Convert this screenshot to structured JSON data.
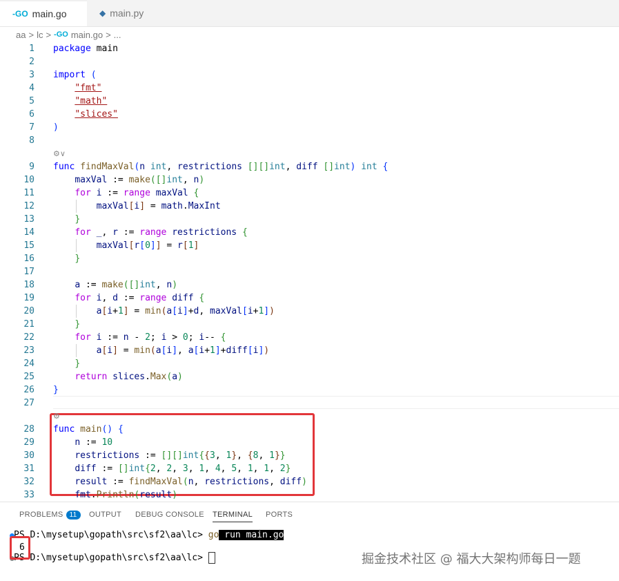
{
  "tabs": [
    {
      "label": "main.go",
      "icon": "go-file-icon",
      "active": true
    },
    {
      "label": "main.py",
      "icon": "python-file-icon",
      "active": false
    }
  ],
  "breadcrumb": {
    "items": [
      "aa",
      ">",
      "lc",
      ">",
      "main.go",
      ">",
      "..."
    ]
  },
  "editor": {
    "code_lines": [
      {
        "n": "1",
        "tokens": [
          [
            "kw",
            "package"
          ],
          [
            "pl",
            " main"
          ]
        ]
      },
      {
        "n": "2",
        "tokens": []
      },
      {
        "n": "3",
        "tokens": [
          [
            "kw",
            "import"
          ],
          [
            "pl",
            " "
          ],
          [
            "p1",
            "("
          ]
        ]
      },
      {
        "n": "4",
        "tokens": [
          [
            "pl",
            "    "
          ],
          [
            "str",
            "\"fmt\""
          ]
        ]
      },
      {
        "n": "5",
        "tokens": [
          [
            "pl",
            "    "
          ],
          [
            "str",
            "\"math\""
          ]
        ]
      },
      {
        "n": "6",
        "tokens": [
          [
            "pl",
            "    "
          ],
          [
            "str",
            "\"slices\""
          ]
        ]
      },
      {
        "n": "7",
        "tokens": [
          [
            "p1",
            ")"
          ]
        ]
      },
      {
        "n": "8",
        "tokens": []
      },
      {
        "lens": "⚙∨"
      },
      {
        "n": "9",
        "tokens": [
          [
            "kw",
            "func"
          ],
          [
            "pl",
            " "
          ],
          [
            "fn",
            "findMaxVal"
          ],
          [
            "p1",
            "("
          ],
          [
            "var",
            "n"
          ],
          [
            "pl",
            " "
          ],
          [
            "ty",
            "int"
          ],
          [
            "pl",
            ", "
          ],
          [
            "var",
            "restrictions"
          ],
          [
            "pl",
            " "
          ],
          [
            "p2",
            "[][]"
          ],
          [
            "ty",
            "int"
          ],
          [
            "pl",
            ", "
          ],
          [
            "var",
            "diff"
          ],
          [
            "pl",
            " "
          ],
          [
            "p2",
            "[]"
          ],
          [
            "ty",
            "int"
          ],
          [
            "p1",
            ")"
          ],
          [
            "pl",
            " "
          ],
          [
            "ty",
            "int"
          ],
          [
            "pl",
            " "
          ],
          [
            "p1",
            "{"
          ]
        ]
      },
      {
        "n": "10",
        "tokens": [
          [
            "pl",
            "    "
          ],
          [
            "var",
            "maxVal"
          ],
          [
            "pl",
            " := "
          ],
          [
            "fn",
            "make"
          ],
          [
            "p2",
            "([]"
          ],
          [
            "ty",
            "int"
          ],
          [
            "pl",
            ", "
          ],
          [
            "var",
            "n"
          ],
          [
            "p2",
            ")"
          ]
        ]
      },
      {
        "n": "11",
        "tokens": [
          [
            "pl",
            "    "
          ],
          [
            "kw2",
            "for"
          ],
          [
            "pl",
            " "
          ],
          [
            "var",
            "i"
          ],
          [
            "pl",
            " := "
          ],
          [
            "kw2",
            "range"
          ],
          [
            "pl",
            " "
          ],
          [
            "var",
            "maxVal"
          ],
          [
            "pl",
            " "
          ],
          [
            "p2",
            "{"
          ]
        ]
      },
      {
        "n": "12",
        "tokens": [
          [
            "pl",
            "        "
          ],
          [
            "var",
            "maxVal"
          ],
          [
            "p3",
            "["
          ],
          [
            "var",
            "i"
          ],
          [
            "p3",
            "]"
          ],
          [
            "pl",
            " = "
          ],
          [
            "var",
            "math"
          ],
          [
            "pl",
            "."
          ],
          [
            "var",
            "MaxInt"
          ]
        ]
      },
      {
        "n": "13",
        "tokens": [
          [
            "pl",
            "    "
          ],
          [
            "p2",
            "}"
          ]
        ]
      },
      {
        "n": "14",
        "tokens": [
          [
            "pl",
            "    "
          ],
          [
            "kw2",
            "for"
          ],
          [
            "pl",
            " "
          ],
          [
            "var",
            "_"
          ],
          [
            "pl",
            ", "
          ],
          [
            "var",
            "r"
          ],
          [
            "pl",
            " := "
          ],
          [
            "kw2",
            "range"
          ],
          [
            "pl",
            " "
          ],
          [
            "var",
            "restrictions"
          ],
          [
            "pl",
            " "
          ],
          [
            "p2",
            "{"
          ]
        ]
      },
      {
        "n": "15",
        "tokens": [
          [
            "pl",
            "        "
          ],
          [
            "var",
            "maxVal"
          ],
          [
            "p3",
            "["
          ],
          [
            "var",
            "r"
          ],
          [
            "p1",
            "["
          ],
          [
            "num",
            "0"
          ],
          [
            "p1",
            "]"
          ],
          [
            "p3",
            "]"
          ],
          [
            "pl",
            " = "
          ],
          [
            "var",
            "r"
          ],
          [
            "p3",
            "["
          ],
          [
            "num",
            "1"
          ],
          [
            "p3",
            "]"
          ]
        ]
      },
      {
        "n": "16",
        "tokens": [
          [
            "pl",
            "    "
          ],
          [
            "p2",
            "}"
          ]
        ]
      },
      {
        "n": "17",
        "tokens": []
      },
      {
        "n": "18",
        "tokens": [
          [
            "pl",
            "    "
          ],
          [
            "var",
            "a"
          ],
          [
            "pl",
            " := "
          ],
          [
            "fn",
            "make"
          ],
          [
            "p2",
            "([]"
          ],
          [
            "ty",
            "int"
          ],
          [
            "pl",
            ", "
          ],
          [
            "var",
            "n"
          ],
          [
            "p2",
            ")"
          ]
        ]
      },
      {
        "n": "19",
        "tokens": [
          [
            "pl",
            "    "
          ],
          [
            "kw2",
            "for"
          ],
          [
            "pl",
            " "
          ],
          [
            "var",
            "i"
          ],
          [
            "pl",
            ", "
          ],
          [
            "var",
            "d"
          ],
          [
            "pl",
            " := "
          ],
          [
            "kw2",
            "range"
          ],
          [
            "pl",
            " "
          ],
          [
            "var",
            "diff"
          ],
          [
            "pl",
            " "
          ],
          [
            "p2",
            "{"
          ]
        ]
      },
      {
        "n": "20",
        "tokens": [
          [
            "pl",
            "        "
          ],
          [
            "var",
            "a"
          ],
          [
            "p3",
            "["
          ],
          [
            "var",
            "i"
          ],
          [
            "pl",
            "+"
          ],
          [
            "num",
            "1"
          ],
          [
            "p3",
            "]"
          ],
          [
            "pl",
            " = "
          ],
          [
            "fn",
            "min"
          ],
          [
            "p3",
            "("
          ],
          [
            "var",
            "a"
          ],
          [
            "p1",
            "["
          ],
          [
            "var",
            "i"
          ],
          [
            "p1",
            "]"
          ],
          [
            "pl",
            "+"
          ],
          [
            "var",
            "d"
          ],
          [
            "pl",
            ", "
          ],
          [
            "var",
            "maxVal"
          ],
          [
            "p1",
            "["
          ],
          [
            "var",
            "i"
          ],
          [
            "pl",
            "+"
          ],
          [
            "num",
            "1"
          ],
          [
            "p1",
            "]"
          ],
          [
            "p3",
            ")"
          ]
        ]
      },
      {
        "n": "21",
        "tokens": [
          [
            "pl",
            "    "
          ],
          [
            "p2",
            "}"
          ]
        ]
      },
      {
        "n": "22",
        "tokens": [
          [
            "pl",
            "    "
          ],
          [
            "kw2",
            "for"
          ],
          [
            "pl",
            " "
          ],
          [
            "var",
            "i"
          ],
          [
            "pl",
            " := "
          ],
          [
            "var",
            "n"
          ],
          [
            "pl",
            " - "
          ],
          [
            "num",
            "2"
          ],
          [
            "pl",
            "; "
          ],
          [
            "var",
            "i"
          ],
          [
            "pl",
            " > "
          ],
          [
            "num",
            "0"
          ],
          [
            "pl",
            "; "
          ],
          [
            "var",
            "i"
          ],
          [
            "pl",
            "-- "
          ],
          [
            "p2",
            "{"
          ]
        ]
      },
      {
        "n": "23",
        "tokens": [
          [
            "pl",
            "        "
          ],
          [
            "var",
            "a"
          ],
          [
            "p3",
            "["
          ],
          [
            "var",
            "i"
          ],
          [
            "p3",
            "]"
          ],
          [
            "pl",
            " = "
          ],
          [
            "fn",
            "min"
          ],
          [
            "p3",
            "("
          ],
          [
            "var",
            "a"
          ],
          [
            "p1",
            "["
          ],
          [
            "var",
            "i"
          ],
          [
            "p1",
            "]"
          ],
          [
            "pl",
            ", "
          ],
          [
            "var",
            "a"
          ],
          [
            "p1",
            "["
          ],
          [
            "var",
            "i"
          ],
          [
            "pl",
            "+"
          ],
          [
            "num",
            "1"
          ],
          [
            "p1",
            "]"
          ],
          [
            "pl",
            "+"
          ],
          [
            "var",
            "diff"
          ],
          [
            "p1",
            "["
          ],
          [
            "var",
            "i"
          ],
          [
            "p1",
            "]"
          ],
          [
            "p3",
            ")"
          ]
        ]
      },
      {
        "n": "24",
        "tokens": [
          [
            "pl",
            "    "
          ],
          [
            "p2",
            "}"
          ]
        ]
      },
      {
        "n": "25",
        "tokens": [
          [
            "pl",
            "    "
          ],
          [
            "kw2",
            "return"
          ],
          [
            "pl",
            " "
          ],
          [
            "var",
            "slices"
          ],
          [
            "pl",
            "."
          ],
          [
            "fn",
            "Max"
          ],
          [
            "p2",
            "("
          ],
          [
            "var",
            "a"
          ],
          [
            "p2",
            ")"
          ]
        ]
      },
      {
        "n": "26",
        "tokens": [
          [
            "p1",
            "}"
          ]
        ]
      },
      {
        "n": "27",
        "tokens": []
      },
      {
        "lens": "⚙"
      },
      {
        "n": "28",
        "tokens": [
          [
            "kw",
            "func"
          ],
          [
            "pl",
            " "
          ],
          [
            "fn",
            "main"
          ],
          [
            "p1",
            "()"
          ],
          [
            "pl",
            " "
          ],
          [
            "p1",
            "{"
          ]
        ]
      },
      {
        "n": "29",
        "tokens": [
          [
            "pl",
            "    "
          ],
          [
            "var",
            "n"
          ],
          [
            "pl",
            " := "
          ],
          [
            "num",
            "10"
          ]
        ]
      },
      {
        "n": "30",
        "tokens": [
          [
            "pl",
            "    "
          ],
          [
            "var",
            "restrictions"
          ],
          [
            "pl",
            " := "
          ],
          [
            "p2",
            "[][]"
          ],
          [
            "ty",
            "int"
          ],
          [
            "p2",
            "{"
          ],
          [
            "p3",
            "{"
          ],
          [
            "num",
            "3"
          ],
          [
            "pl",
            ", "
          ],
          [
            "num",
            "1"
          ],
          [
            "p3",
            "}"
          ],
          [
            "pl",
            ", "
          ],
          [
            "p3",
            "{"
          ],
          [
            "num",
            "8"
          ],
          [
            "pl",
            ", "
          ],
          [
            "num",
            "1"
          ],
          [
            "p3",
            "}"
          ],
          [
            "p2",
            "}"
          ]
        ]
      },
      {
        "n": "31",
        "tokens": [
          [
            "pl",
            "    "
          ],
          [
            "var",
            "diff"
          ],
          [
            "pl",
            " := "
          ],
          [
            "p2",
            "[]"
          ],
          [
            "ty",
            "int"
          ],
          [
            "p2",
            "{"
          ],
          [
            "num",
            "2"
          ],
          [
            "pl",
            ", "
          ],
          [
            "num",
            "2"
          ],
          [
            "pl",
            ", "
          ],
          [
            "num",
            "3"
          ],
          [
            "pl",
            ", "
          ],
          [
            "num",
            "1"
          ],
          [
            "pl",
            ", "
          ],
          [
            "num",
            "4"
          ],
          [
            "pl",
            ", "
          ],
          [
            "num",
            "5"
          ],
          [
            "pl",
            ", "
          ],
          [
            "num",
            "1"
          ],
          [
            "pl",
            ", "
          ],
          [
            "num",
            "1"
          ],
          [
            "pl",
            ", "
          ],
          [
            "num",
            "2"
          ],
          [
            "p2",
            "}"
          ]
        ]
      },
      {
        "n": "32",
        "tokens": [
          [
            "pl",
            "    "
          ],
          [
            "var",
            "result"
          ],
          [
            "pl",
            " := "
          ],
          [
            "fn",
            "findMaxVal"
          ],
          [
            "p2",
            "("
          ],
          [
            "var",
            "n"
          ],
          [
            "pl",
            ", "
          ],
          [
            "var",
            "restrictions"
          ],
          [
            "pl",
            ", "
          ],
          [
            "var",
            "diff"
          ],
          [
            "p2",
            ")"
          ]
        ]
      },
      {
        "n": "33",
        "tokens": [
          [
            "pl",
            "    "
          ],
          [
            "var",
            "fmt"
          ],
          [
            "pl",
            "."
          ],
          [
            "fn",
            "Println"
          ],
          [
            "p2",
            "("
          ],
          [
            "var",
            "result"
          ],
          [
            "p2",
            ")"
          ]
        ]
      }
    ]
  },
  "panel": {
    "tabs": [
      {
        "label": "PROBLEMS",
        "badge": "11"
      },
      {
        "label": "OUTPUT"
      },
      {
        "label": "DEBUG CONSOLE"
      },
      {
        "label": "TERMINAL",
        "active": true
      },
      {
        "label": "PORTS"
      }
    ],
    "terminal": {
      "line1_prompt": "PS D:\\mysetup\\gopath\\src\\sf2\\aa\\lc> ",
      "line1_cmd": "go",
      "line1_args": " run main.go",
      "output": "6",
      "line3_prompt": "PS D:\\mysetup\\gopath\\src\\sf2\\aa\\lc> "
    }
  },
  "watermark": "掘金技术社区 @ 福大大架构师每日一题",
  "colors": {
    "highlight_border": "#e2363a",
    "keyword": "#0000ff",
    "control": "#af00db",
    "function": "#795e26",
    "type": "#267f99",
    "string": "#a31515",
    "number": "#098658",
    "variable": "#001080",
    "line_number": "#237893",
    "badge": "#007acc"
  }
}
